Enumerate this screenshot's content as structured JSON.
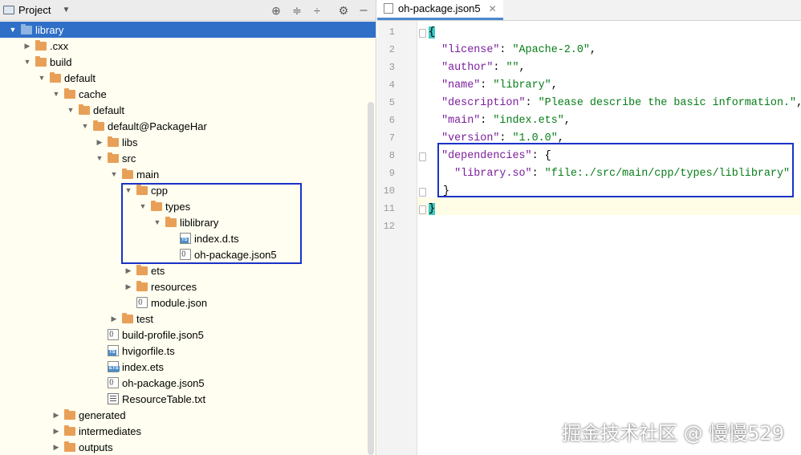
{
  "project_panel": {
    "title": "Project",
    "tree": [
      {
        "label": "library",
        "depth": 0,
        "type": "folder-blue",
        "arrow": "down",
        "selected": true
      },
      {
        "label": ".cxx",
        "depth": 1,
        "type": "folder",
        "arrow": "right"
      },
      {
        "label": "build",
        "depth": 1,
        "type": "folder",
        "arrow": "down"
      },
      {
        "label": "default",
        "depth": 2,
        "type": "folder",
        "arrow": "down"
      },
      {
        "label": "cache",
        "depth": 3,
        "type": "folder",
        "arrow": "down"
      },
      {
        "label": "default",
        "depth": 4,
        "type": "folder",
        "arrow": "down"
      },
      {
        "label": "default@PackageHar",
        "depth": 5,
        "type": "folder",
        "arrow": "down"
      },
      {
        "label": "libs",
        "depth": 6,
        "type": "folder",
        "arrow": "right"
      },
      {
        "label": "src",
        "depth": 6,
        "type": "folder",
        "arrow": "down"
      },
      {
        "label": "main",
        "depth": 7,
        "type": "folder",
        "arrow": "down"
      },
      {
        "label": "cpp",
        "depth": 8,
        "type": "folder",
        "arrow": "down"
      },
      {
        "label": "types",
        "depth": 9,
        "type": "folder",
        "arrow": "down"
      },
      {
        "label": "liblibrary",
        "depth": 10,
        "type": "folder",
        "arrow": "down"
      },
      {
        "label": "index.d.ts",
        "depth": 11,
        "type": "ts",
        "arrow": ""
      },
      {
        "label": "oh-package.json5",
        "depth": 11,
        "type": "json",
        "arrow": ""
      },
      {
        "label": "ets",
        "depth": 8,
        "type": "folder",
        "arrow": "right"
      },
      {
        "label": "resources",
        "depth": 8,
        "type": "folder",
        "arrow": "right"
      },
      {
        "label": "module.json",
        "depth": 8,
        "type": "json",
        "arrow": ""
      },
      {
        "label": "test",
        "depth": 7,
        "type": "folder",
        "arrow": "right"
      },
      {
        "label": "build-profile.json5",
        "depth": 6,
        "type": "json",
        "arrow": ""
      },
      {
        "label": "hvigorfile.ts",
        "depth": 6,
        "type": "ts",
        "arrow": ""
      },
      {
        "label": "index.ets",
        "depth": 6,
        "type": "ets",
        "arrow": ""
      },
      {
        "label": "oh-package.json5",
        "depth": 6,
        "type": "json",
        "arrow": ""
      },
      {
        "label": "ResourceTable.txt",
        "depth": 6,
        "type": "txt",
        "arrow": ""
      },
      {
        "label": "generated",
        "depth": 3,
        "type": "folder",
        "arrow": "right"
      },
      {
        "label": "intermediates",
        "depth": 3,
        "type": "folder",
        "arrow": "right"
      },
      {
        "label": "outputs",
        "depth": 3,
        "type": "folder",
        "arrow": "right"
      }
    ]
  },
  "editor": {
    "tab_label": "oh-package.json5",
    "lines": [
      {
        "n": "1",
        "k": "",
        "s": "",
        "open": "{"
      },
      {
        "n": "2",
        "k": "\"license\"",
        "s": "\"Apache-2.0\"",
        "tail": ","
      },
      {
        "n": "3",
        "k": "\"author\"",
        "s": "\"\"",
        "tail": ","
      },
      {
        "n": "4",
        "k": "\"name\"",
        "s": "\"library\"",
        "tail": ","
      },
      {
        "n": "5",
        "k": "\"description\"",
        "s": "\"Please describe the basic information.\"",
        "tail": ","
      },
      {
        "n": "6",
        "k": "\"main\"",
        "s": "\"index.ets\"",
        "tail": ","
      },
      {
        "n": "7",
        "k": "\"version\"",
        "s": "\"1.0.0\"",
        "tail": ","
      },
      {
        "n": "8",
        "k": "\"dependencies\"",
        "s": "",
        "tail": "{"
      },
      {
        "n": "9",
        "k": "\"library.so\"",
        "s": "\"file:./src/main/cpp/types/liblibrary\"",
        "tail": ""
      },
      {
        "n": "10",
        "k": "",
        "s": "",
        "close": "}"
      },
      {
        "n": "11",
        "k": "",
        "s": "",
        "close": "}"
      },
      {
        "n": "12",
        "k": "",
        "s": ""
      }
    ]
  },
  "watermark": "掘金技术社区 @ 慢慢529"
}
